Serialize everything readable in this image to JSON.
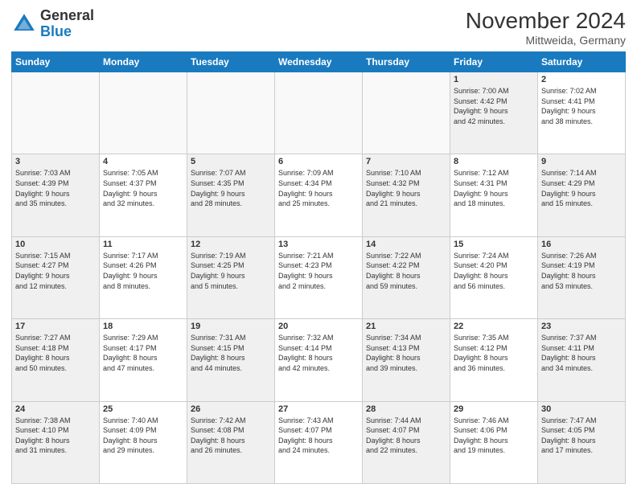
{
  "header": {
    "logo_general": "General",
    "logo_blue": "Blue",
    "month_title": "November 2024",
    "subtitle": "Mittweida, Germany"
  },
  "days_of_week": [
    "Sunday",
    "Monday",
    "Tuesday",
    "Wednesday",
    "Thursday",
    "Friday",
    "Saturday"
  ],
  "weeks": [
    [
      {
        "day": "",
        "info": "",
        "empty": true
      },
      {
        "day": "",
        "info": "",
        "empty": true
      },
      {
        "day": "",
        "info": "",
        "empty": true
      },
      {
        "day": "",
        "info": "",
        "empty": true
      },
      {
        "day": "",
        "info": "",
        "empty": true
      },
      {
        "day": "1",
        "info": "Sunrise: 7:00 AM\nSunset: 4:42 PM\nDaylight: 9 hours\nand 42 minutes.",
        "shaded": true
      },
      {
        "day": "2",
        "info": "Sunrise: 7:02 AM\nSunset: 4:41 PM\nDaylight: 9 hours\nand 38 minutes.",
        "shaded": false
      }
    ],
    [
      {
        "day": "3",
        "info": "Sunrise: 7:03 AM\nSunset: 4:39 PM\nDaylight: 9 hours\nand 35 minutes.",
        "shaded": true
      },
      {
        "day": "4",
        "info": "Sunrise: 7:05 AM\nSunset: 4:37 PM\nDaylight: 9 hours\nand 32 minutes.",
        "shaded": false
      },
      {
        "day": "5",
        "info": "Sunrise: 7:07 AM\nSunset: 4:35 PM\nDaylight: 9 hours\nand 28 minutes.",
        "shaded": true
      },
      {
        "day": "6",
        "info": "Sunrise: 7:09 AM\nSunset: 4:34 PM\nDaylight: 9 hours\nand 25 minutes.",
        "shaded": false
      },
      {
        "day": "7",
        "info": "Sunrise: 7:10 AM\nSunset: 4:32 PM\nDaylight: 9 hours\nand 21 minutes.",
        "shaded": true
      },
      {
        "day": "8",
        "info": "Sunrise: 7:12 AM\nSunset: 4:31 PM\nDaylight: 9 hours\nand 18 minutes.",
        "shaded": false
      },
      {
        "day": "9",
        "info": "Sunrise: 7:14 AM\nSunset: 4:29 PM\nDaylight: 9 hours\nand 15 minutes.",
        "shaded": true
      }
    ],
    [
      {
        "day": "10",
        "info": "Sunrise: 7:15 AM\nSunset: 4:27 PM\nDaylight: 9 hours\nand 12 minutes.",
        "shaded": true
      },
      {
        "day": "11",
        "info": "Sunrise: 7:17 AM\nSunset: 4:26 PM\nDaylight: 9 hours\nand 8 minutes.",
        "shaded": false
      },
      {
        "day": "12",
        "info": "Sunrise: 7:19 AM\nSunset: 4:25 PM\nDaylight: 9 hours\nand 5 minutes.",
        "shaded": true
      },
      {
        "day": "13",
        "info": "Sunrise: 7:21 AM\nSunset: 4:23 PM\nDaylight: 9 hours\nand 2 minutes.",
        "shaded": false
      },
      {
        "day": "14",
        "info": "Sunrise: 7:22 AM\nSunset: 4:22 PM\nDaylight: 8 hours\nand 59 minutes.",
        "shaded": true
      },
      {
        "day": "15",
        "info": "Sunrise: 7:24 AM\nSunset: 4:20 PM\nDaylight: 8 hours\nand 56 minutes.",
        "shaded": false
      },
      {
        "day": "16",
        "info": "Sunrise: 7:26 AM\nSunset: 4:19 PM\nDaylight: 8 hours\nand 53 minutes.",
        "shaded": true
      }
    ],
    [
      {
        "day": "17",
        "info": "Sunrise: 7:27 AM\nSunset: 4:18 PM\nDaylight: 8 hours\nand 50 minutes.",
        "shaded": true
      },
      {
        "day": "18",
        "info": "Sunrise: 7:29 AM\nSunset: 4:17 PM\nDaylight: 8 hours\nand 47 minutes.",
        "shaded": false
      },
      {
        "day": "19",
        "info": "Sunrise: 7:31 AM\nSunset: 4:15 PM\nDaylight: 8 hours\nand 44 minutes.",
        "shaded": true
      },
      {
        "day": "20",
        "info": "Sunrise: 7:32 AM\nSunset: 4:14 PM\nDaylight: 8 hours\nand 42 minutes.",
        "shaded": false
      },
      {
        "day": "21",
        "info": "Sunrise: 7:34 AM\nSunset: 4:13 PM\nDaylight: 8 hours\nand 39 minutes.",
        "shaded": true
      },
      {
        "day": "22",
        "info": "Sunrise: 7:35 AM\nSunset: 4:12 PM\nDaylight: 8 hours\nand 36 minutes.",
        "shaded": false
      },
      {
        "day": "23",
        "info": "Sunrise: 7:37 AM\nSunset: 4:11 PM\nDaylight: 8 hours\nand 34 minutes.",
        "shaded": true
      }
    ],
    [
      {
        "day": "24",
        "info": "Sunrise: 7:38 AM\nSunset: 4:10 PM\nDaylight: 8 hours\nand 31 minutes.",
        "shaded": true
      },
      {
        "day": "25",
        "info": "Sunrise: 7:40 AM\nSunset: 4:09 PM\nDaylight: 8 hours\nand 29 minutes.",
        "shaded": false
      },
      {
        "day": "26",
        "info": "Sunrise: 7:42 AM\nSunset: 4:08 PM\nDaylight: 8 hours\nand 26 minutes.",
        "shaded": true
      },
      {
        "day": "27",
        "info": "Sunrise: 7:43 AM\nSunset: 4:07 PM\nDaylight: 8 hours\nand 24 minutes.",
        "shaded": false
      },
      {
        "day": "28",
        "info": "Sunrise: 7:44 AM\nSunset: 4:07 PM\nDaylight: 8 hours\nand 22 minutes.",
        "shaded": true
      },
      {
        "day": "29",
        "info": "Sunrise: 7:46 AM\nSunset: 4:06 PM\nDaylight: 8 hours\nand 19 minutes.",
        "shaded": false
      },
      {
        "day": "30",
        "info": "Sunrise: 7:47 AM\nSunset: 4:05 PM\nDaylight: 8 hours\nand 17 minutes.",
        "shaded": true
      }
    ]
  ]
}
